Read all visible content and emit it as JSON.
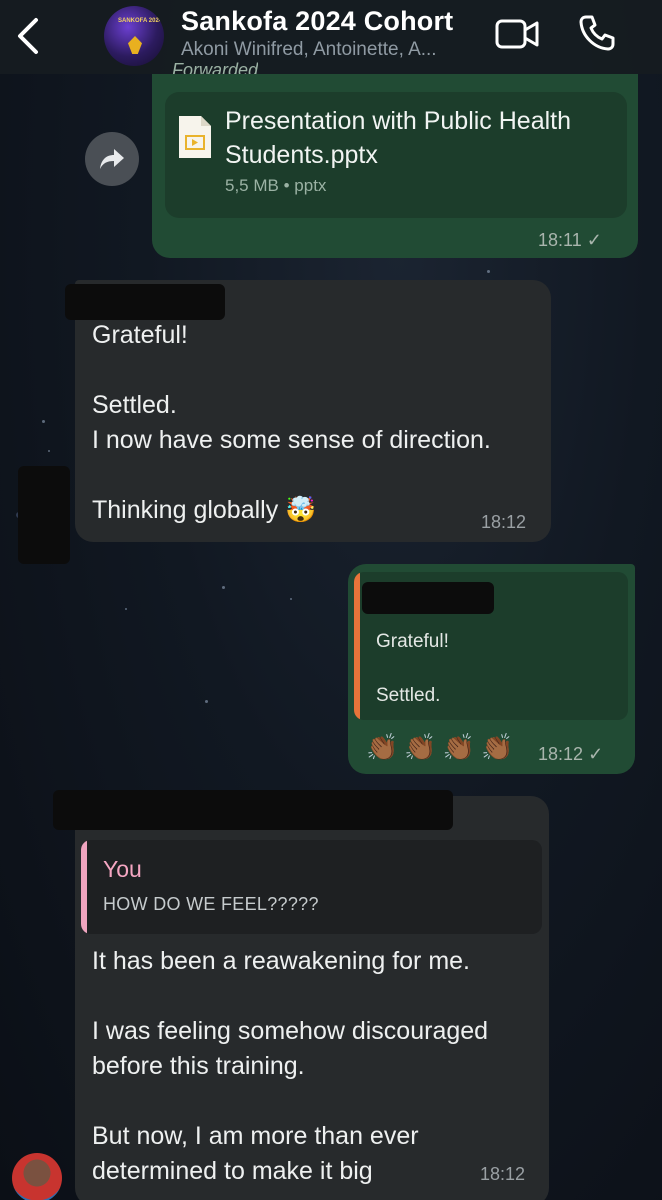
{
  "header": {
    "title": "Sankofa 2024 Cohort",
    "members": "Akoni Winifred, Antoinette, A...",
    "avatar_caption": "SANKOFA 2024",
    "back_icon": "chevron-left-icon",
    "video_icon": "video-camera-icon",
    "call_icon": "phone-icon"
  },
  "messages": [
    {
      "type": "document",
      "direction": "outgoing",
      "forwarded_label": "Forwarded",
      "file_name": "Presentation with Public Health Students.pptx",
      "file_size": "5,5 MB",
      "file_type": "pptx",
      "time": "18:11",
      "status": "✓"
    },
    {
      "type": "text",
      "direction": "incoming",
      "text": "Grateful!\n\nSettled.\nI now have some sense of direction.\n\nThinking globally 🤯",
      "time": "18:12"
    },
    {
      "type": "quote",
      "direction": "outgoing",
      "quoted_text": "Grateful!\n\nSettled.",
      "reaction": "👏🏾👏🏾👏🏾👏🏾",
      "time": "18:12",
      "status": "✓"
    },
    {
      "type": "reply",
      "direction": "incoming",
      "reply_to_author": "You",
      "reply_to_text": "HOW DO WE FEEL?????",
      "text": "It has been a reawakening for me.\n\nI was feeling somehow discouraged before this training.\n\nBut now, I am more than ever determined to make it big",
      "time": "18:12"
    }
  ],
  "colors": {
    "outgoing_bubble": "#214b34",
    "incoming_bubble": "#272a2c",
    "quote_accent": "#e8743a",
    "reply_accent": "#f0a5c0"
  }
}
